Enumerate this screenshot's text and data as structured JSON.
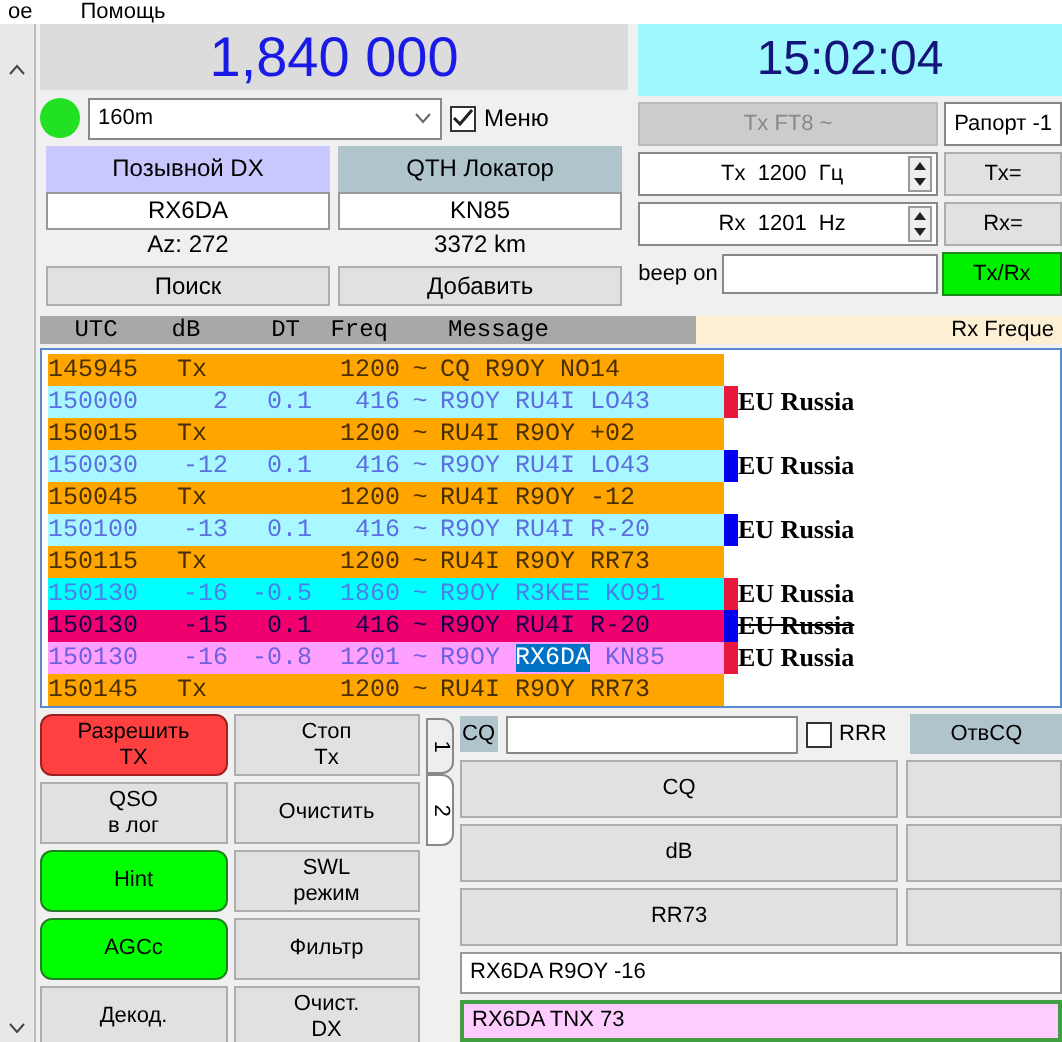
{
  "menu": [
    "ое",
    "Помощь"
  ],
  "frequency": "1,840 000",
  "status_led": {
    "on": true
  },
  "band": {
    "value": "160m"
  },
  "menu_toggle": {
    "label": "Меню",
    "checked": true
  },
  "dx_call": {
    "header": "Позывной DX",
    "value": "RX6DA",
    "info": "Az: 272",
    "button": "Поиск"
  },
  "dx_grid": {
    "header": "QTH Локатор",
    "value": "KN85",
    "info": "3372 km",
    "button": "Добавить"
  },
  "clock": "15:02:04",
  "tx_mode": {
    "label": "Tx FT8 ~",
    "disabled": true
  },
  "report": {
    "value": "Рапорт -1"
  },
  "tx_freq": {
    "value": "Tx  1200  Гц",
    "button": "Tx="
  },
  "rx_freq": {
    "value": "Rx  1201  Hz",
    "button": "Rx="
  },
  "beep": {
    "label": "beep on"
  },
  "txrx_button": {
    "label": "Tx/Rx",
    "on": true
  },
  "columns": [
    "UTC",
    "dB",
    "DT",
    "Freq",
    "Message"
  ],
  "rx_frequency_header": "Rx Freque",
  "messages": [
    {
      "kind": "tx",
      "utc": "145945",
      "db": "Tx",
      "freq": "1200",
      "mode": "~",
      "parts": [
        {
          "text": "CQ R9OY NO14",
          "highlighted": false
        }
      ]
    },
    {
      "kind": "rx",
      "utc": "150000",
      "db": "2",
      "dt": "0.1",
      "freq": "416",
      "mode": "~",
      "parts": [
        {
          "text": "R9OY RU4I LO43",
          "highlighted": false
        }
      ],
      "color": "#e8183c",
      "country": "EU Russia"
    },
    {
      "kind": "tx",
      "utc": "150015",
      "db": "Tx",
      "freq": "1200",
      "mode": "~",
      "parts": [
        {
          "text": "RU4I R9OY +02",
          "highlighted": false
        }
      ]
    },
    {
      "kind": "rx",
      "utc": "150030",
      "db": "-12",
      "dt": "0.1",
      "freq": "416",
      "mode": "~",
      "parts": [
        {
          "text": "R9OY RU4I LO43",
          "highlighted": false
        }
      ],
      "color": "#0000ee",
      "country": "EU Russia"
    },
    {
      "kind": "tx",
      "utc": "150045",
      "db": "Tx",
      "freq": "1200",
      "mode": "~",
      "parts": [
        {
          "text": "RU4I R9OY -12",
          "highlighted": false
        }
      ]
    },
    {
      "kind": "rx",
      "utc": "150100",
      "db": "-13",
      "dt": "0.1",
      "freq": "416",
      "mode": "~",
      "parts": [
        {
          "text": "R9OY RU4I R-20",
          "highlighted": false
        }
      ],
      "color": "#0000ee",
      "country": "EU Russia"
    },
    {
      "kind": "tx",
      "utc": "150115",
      "db": "Tx",
      "freq": "1200",
      "mode": "~",
      "parts": [
        {
          "text": "RU4I R9OY RR73",
          "highlighted": false
        }
      ]
    },
    {
      "kind": "rx_new",
      "utc": "150130",
      "db": "-16",
      "dt": "-0.5",
      "freq": "1860",
      "mode": "~",
      "parts": [
        {
          "text": "R9OY R3KEE KO91",
          "highlighted": false
        }
      ],
      "color": "#e8183c",
      "country": "EU Russia"
    },
    {
      "kind": "rx_struck",
      "utc": "150130",
      "db": "-15",
      "dt": "0.1",
      "freq": "416",
      "mode": "~",
      "parts": [
        {
          "text": "R9OY RU4I R-20",
          "highlighted": false
        }
      ],
      "color": "#0000ee",
      "country": "EU Russia"
    },
    {
      "kind": "rx_me",
      "utc": "150130",
      "db": "-16",
      "dt": "-0.8",
      "freq": "1201",
      "mode": "~",
      "parts": [
        {
          "text": "R9OY ",
          "highlighted": false
        },
        {
          "text": "RX6DA",
          "highlighted": true
        },
        {
          "text": " KN85",
          "highlighted": false
        }
      ],
      "color": "#e8183c",
      "country": "EU Russia"
    },
    {
      "kind": "tx",
      "utc": "150145",
      "db": "Tx",
      "freq": "1200",
      "mode": "~",
      "parts": [
        {
          "text": "RU4I R9OY RR73",
          "highlighted": false
        }
      ]
    }
  ],
  "control_buttons": [
    {
      "kind": "enable",
      "lines": [
        "Разрешить",
        "TX"
      ],
      "on": true
    },
    {
      "kind": "action",
      "lines": [
        "Стоп",
        "Tx"
      ]
    },
    {
      "kind": "action",
      "lines": [
        "QSO",
        "в лог"
      ]
    },
    {
      "kind": "action",
      "lines": [
        "Очистить"
      ]
    },
    {
      "kind": "toggle",
      "lines": [
        "Hint"
      ],
      "on": true
    },
    {
      "kind": "action",
      "lines": [
        "SWL",
        "режим"
      ]
    },
    {
      "kind": "toggle",
      "lines": [
        "AGCc"
      ],
      "on": true
    },
    {
      "kind": "action",
      "lines": [
        "Фильтр"
      ]
    },
    {
      "kind": "action",
      "lines": [
        "Декод."
      ]
    },
    {
      "kind": "action",
      "lines": [
        "Очист.",
        "DX"
      ]
    }
  ],
  "tabs": [
    {
      "label": "1",
      "selected": false
    },
    {
      "label": "2",
      "selected": true
    }
  ],
  "cq_label": "CQ",
  "rrr": {
    "label": "RRR",
    "checked": false
  },
  "answer_cq_button": "ОтвCQ",
  "macro_buttons": [
    "CQ",
    "dB",
    "RR73"
  ],
  "tx_message_1": "RX6DA R9OY -16",
  "tx_message_2": {
    "value": "RX6DA TNX 73",
    "active": true
  }
}
